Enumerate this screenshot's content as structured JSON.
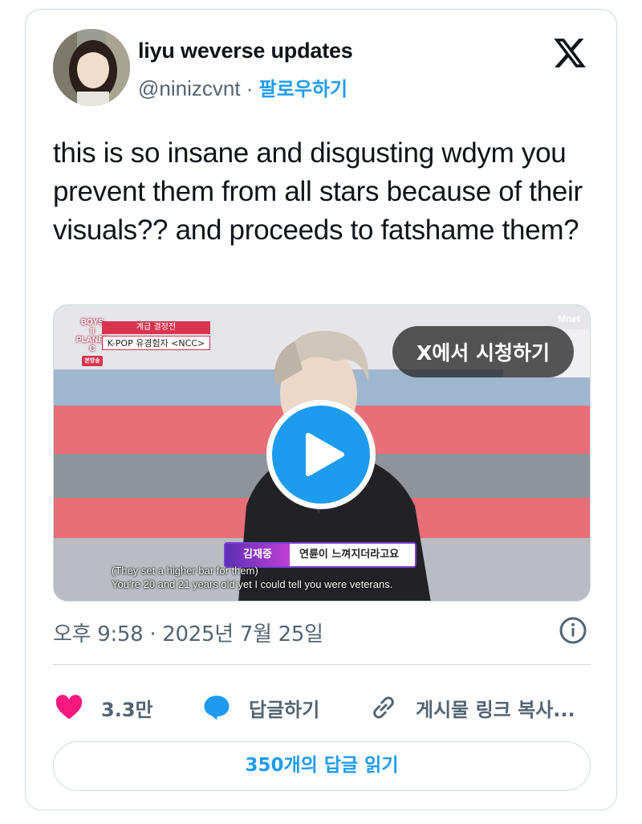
{
  "author": {
    "display_name": "liyu weverse updates",
    "handle": "@ninizcvnt",
    "separator": "·",
    "follow_label": "팔로우하기"
  },
  "platform_icon": "x-logo-icon",
  "tweet": {
    "text": "this is so insane and disgusting wdym you prevent them from all stars because of their visuals?? and proceeds to fatshame them?"
  },
  "media": {
    "watch_on_x_label": "X에서 시청하기",
    "play_icon": "play-icon",
    "show_logo_lines": [
      "BOYS",
      "II",
      "PLANET",
      "C"
    ],
    "show_logo_tag": "본방송",
    "badge_top": "계급 결정전",
    "badge_bottom": "K-POP 유경험자 <NCC>",
    "lower_third_name": "김재중",
    "lower_third_quote": "연륜이 느껴지더라고요",
    "subtitle_line_1": "(They set a higher bar for them)",
    "subtitle_line_2": "You're 20 and 21 years old yet I could tell you were veterans.",
    "channel_stamp": "Mnet"
  },
  "timestamp": "오후 9:58 · 2025년 7월 25일",
  "actions": {
    "like_count": "3.3만",
    "reply_label": "답글하기",
    "copy_link_label": "게시물 링크 복사..."
  },
  "read_replies_label": "350개의 답글 읽기",
  "colors": {
    "accent": "#1d9bf0",
    "like": "#f91880",
    "border": "#cfd9de",
    "secondary_text": "#536471"
  }
}
